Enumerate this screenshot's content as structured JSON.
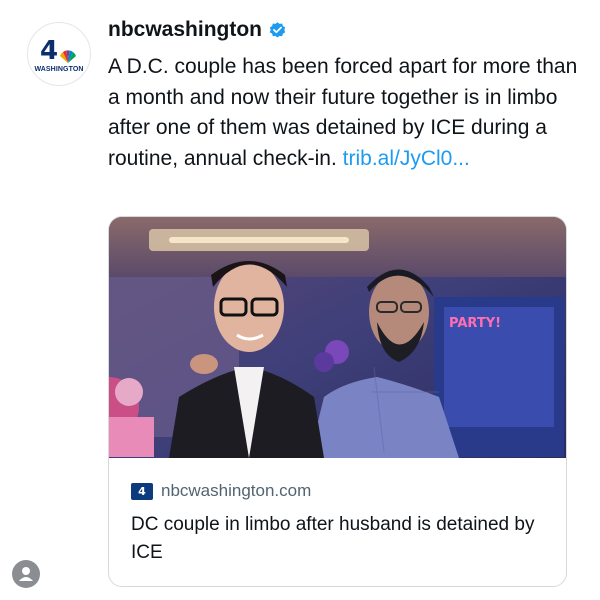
{
  "account": {
    "name": "nbcwashington",
    "verified": true,
    "avatar_number": "4",
    "avatar_city": "WASHINGTON"
  },
  "post": {
    "text": "A D.C. couple has been forced apart for more than a month and now their future together is in limbo after one of them was detained by ICE during a routine, annual check-in.",
    "link": "trib.al/JyCl0..."
  },
  "card": {
    "image_overlay_text": "PARTY!",
    "logo_text": "4",
    "domain": "nbcwashington.com",
    "title": "DC couple in limbo after husband is detained by ICE"
  },
  "colors": {
    "link": "#1d9bf0",
    "verified_badge": "#1d9bf0",
    "brand_navy": "#0b2f6b"
  },
  "icons": {
    "verified": "verified-badge-icon",
    "peacock": "peacock-icon",
    "user": "user-icon"
  }
}
